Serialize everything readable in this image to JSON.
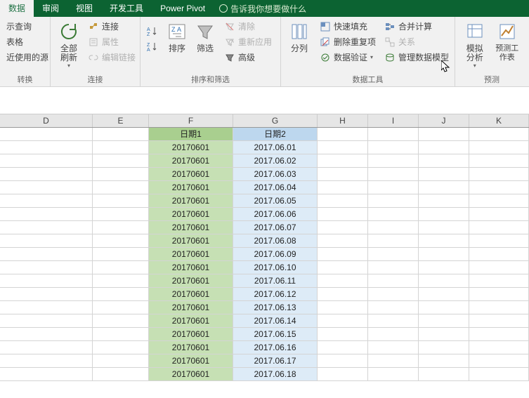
{
  "tabs": {
    "data": "数据",
    "review": "审阅",
    "view": "视图",
    "dev": "开发工具",
    "powerpivot": "Power Pivot"
  },
  "tell_me": "告诉我你想要做什么",
  "ribbon": {
    "external": {
      "show_queries": "示查询",
      "from_table": "表格",
      "recent_sources": "近使用的源",
      "transform": "转换"
    },
    "connections": {
      "refresh_all": "全部刷新",
      "connections": "连接",
      "properties": "属性",
      "edit_links": "编辑链接",
      "group_label": "连接"
    },
    "sort_filter": {
      "sort": "排序",
      "filter": "筛选",
      "clear": "清除",
      "reapply": "重新应用",
      "advanced": "高级",
      "group_label": "排序和筛选"
    },
    "data_tools": {
      "text_to_columns": "分列",
      "flash_fill": "快速填充",
      "remove_dup": "删除重复项",
      "data_validation": "数据验证",
      "consolidate": "合并计算",
      "relationships": "关系",
      "manage_model": "管理数据模型",
      "group_label": "数据工具"
    },
    "forecast": {
      "what_if": "模拟分析",
      "forecast_sheet": "预测工作表",
      "group_label": "预测"
    }
  },
  "columns": {
    "D": "D",
    "E": "E",
    "F": "F",
    "G": "G",
    "H": "H",
    "I": "I",
    "J": "J",
    "K": "K"
  },
  "headers": {
    "F": "日期1",
    "G": "日期2"
  },
  "rows": [
    {
      "F": "20170601",
      "G": "2017.06.01"
    },
    {
      "F": "20170601",
      "G": "2017.06.02"
    },
    {
      "F": "20170601",
      "G": "2017.06.03"
    },
    {
      "F": "20170601",
      "G": "2017.06.04"
    },
    {
      "F": "20170601",
      "G": "2017.06.05"
    },
    {
      "F": "20170601",
      "G": "2017.06.06"
    },
    {
      "F": "20170601",
      "G": "2017.06.07"
    },
    {
      "F": "20170601",
      "G": "2017.06.08"
    },
    {
      "F": "20170601",
      "G": "2017.06.09"
    },
    {
      "F": "20170601",
      "G": "2017.06.10"
    },
    {
      "F": "20170601",
      "G": "2017.06.11"
    },
    {
      "F": "20170601",
      "G": "2017.06.12"
    },
    {
      "F": "20170601",
      "G": "2017.06.13"
    },
    {
      "F": "20170601",
      "G": "2017.06.14"
    },
    {
      "F": "20170601",
      "G": "2017.06.15"
    },
    {
      "F": "20170601",
      "G": "2017.06.16"
    },
    {
      "F": "20170601",
      "G": "2017.06.17"
    },
    {
      "F": "20170601",
      "G": "2017.06.18"
    }
  ]
}
